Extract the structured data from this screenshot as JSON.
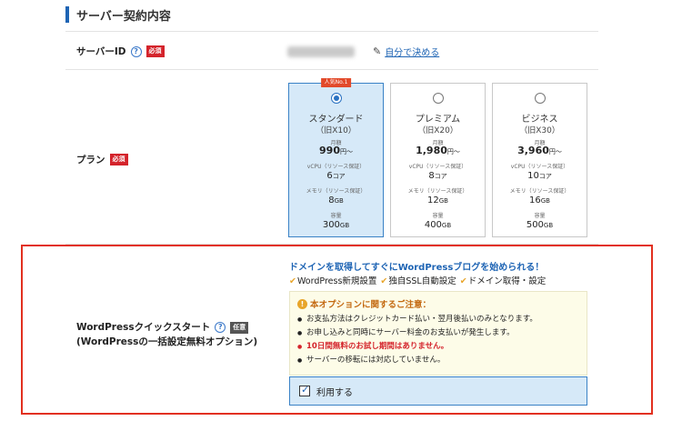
{
  "section": {
    "title": "サーバー契約内容"
  },
  "server_id": {
    "label": "サーバーID",
    "help": "?",
    "required": "必須",
    "self_link": "自分で決める"
  },
  "plan": {
    "label": "プラン",
    "required": "必須",
    "options": [
      {
        "ribbon": "人気No.1",
        "name": "スタンダード",
        "old": "（旧X10）",
        "monthly": "月額",
        "price": "990",
        "price_unit": "円〜",
        "vcpu_label": "vCPU（リソース保証）",
        "vcpu": "6",
        "vcpu_unit": "コア",
        "mem_label": "メモリ（リソース保証）",
        "mem": "8",
        "mem_unit": "GB",
        "disk_label": "容量",
        "disk": "300",
        "disk_unit": "GB",
        "selected": true
      },
      {
        "ribbon": "",
        "name": "プレミアム",
        "old": "（旧X20）",
        "monthly": "月額",
        "price": "1,980",
        "price_unit": "円〜",
        "vcpu_label": "vCPU（リソース保証）",
        "vcpu": "8",
        "vcpu_unit": "コア",
        "mem_label": "メモリ（リソース保証）",
        "mem": "12",
        "mem_unit": "GB",
        "disk_label": "容量",
        "disk": "400",
        "disk_unit": "GB",
        "selected": false
      },
      {
        "ribbon": "",
        "name": "ビジネス",
        "old": "（旧X30）",
        "monthly": "月額",
        "price": "3,960",
        "price_unit": "円〜",
        "vcpu_label": "vCPU（リソース保証）",
        "vcpu": "10",
        "vcpu_unit": "コア",
        "mem_label": "メモリ（リソース保証）",
        "mem": "16",
        "mem_unit": "GB",
        "disk_label": "容量",
        "disk": "500",
        "disk_unit": "GB",
        "selected": false
      }
    ]
  },
  "wordpress": {
    "label_line1": "WordPressクイックスタート",
    "label_line2": "(WordPressの一括設定無料オプション)",
    "help": "?",
    "optional": "任意",
    "headline": "ドメインを取得してすぐにWordPressブログを始められる！",
    "features": [
      "WordPress新規設置",
      "独自SSL自動設定",
      "ドメイン取得・設定"
    ],
    "notice_title": "本オプションに関するご注意：",
    "notices": [
      "お支払方法はクレジットカード払い・翌月後払いのみとなります。",
      "お申し込みと同時にサーバー料金のお支払いが発生します。",
      "10日間無料のお試し期間はありません。",
      "サーバーの移転には対応していません。"
    ],
    "use_label": "利用する",
    "use_checked": true
  },
  "colors": {
    "accent": "#1e64b4",
    "required": "#d4232b",
    "highlight_border": "#e2301f",
    "selected_bg": "#d6e9f8"
  }
}
